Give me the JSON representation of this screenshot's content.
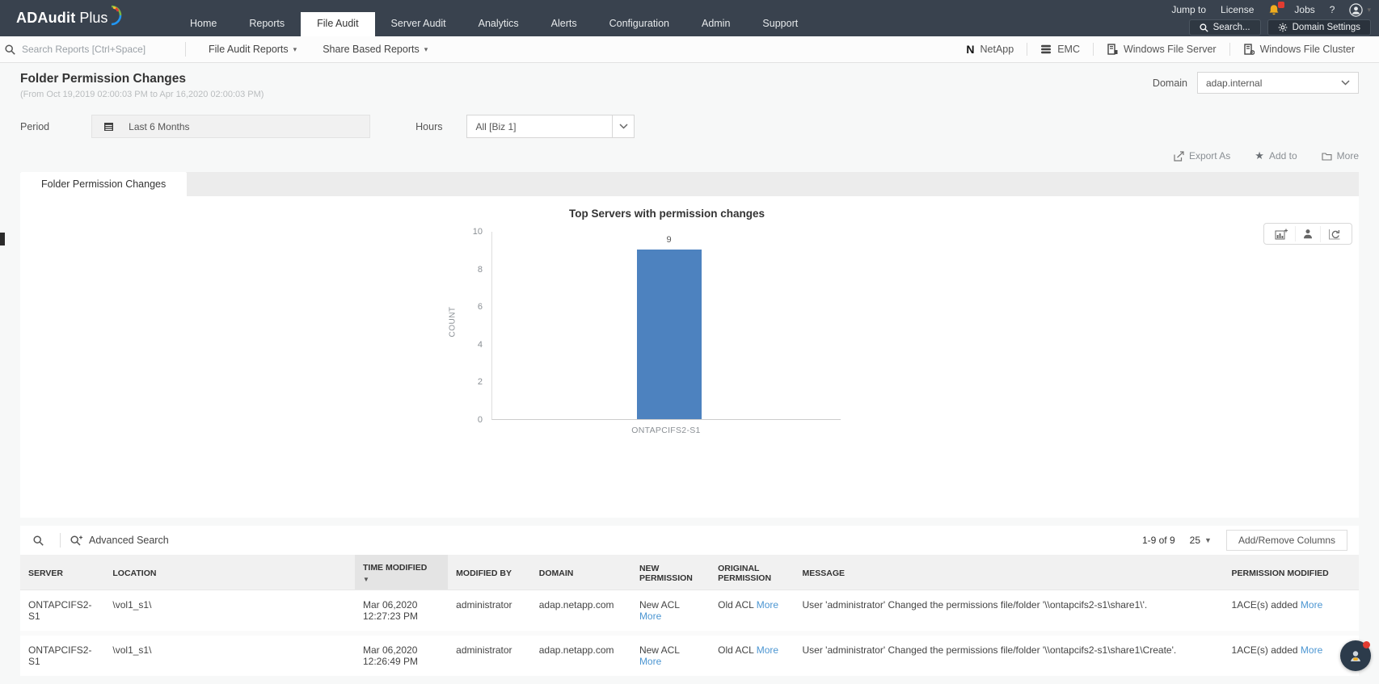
{
  "header": {
    "logo_bold": "ADAudit",
    "logo_light": "Plus",
    "nav": [
      {
        "label": "Home",
        "active": false
      },
      {
        "label": "Reports",
        "active": false
      },
      {
        "label": "File Audit",
        "active": true
      },
      {
        "label": "Server Audit",
        "active": false
      },
      {
        "label": "Analytics",
        "active": false
      },
      {
        "label": "Alerts",
        "active": false
      },
      {
        "label": "Configuration",
        "active": false
      },
      {
        "label": "Admin",
        "active": false
      },
      {
        "label": "Support",
        "active": false
      }
    ],
    "jump_to": "Jump to",
    "license": "License",
    "jobs": "Jobs",
    "help": "?",
    "search_button": "Search...",
    "domain_settings_button": "Domain Settings"
  },
  "toolbar": {
    "search_placeholder": "Search Reports [Ctrl+Space]",
    "dropdowns": [
      "File Audit Reports",
      "Share Based Reports"
    ],
    "storage_links": [
      {
        "label": "NetApp",
        "name": "netapp-button",
        "icon": "netapp-icon"
      },
      {
        "label": "EMC",
        "name": "emc-button",
        "icon": "emc-icon"
      },
      {
        "label": "Windows File Server",
        "name": "windows-file-server-button",
        "icon": "file-server-icon"
      },
      {
        "label": "Windows File Cluster",
        "name": "windows-file-cluster-button",
        "icon": "file-cluster-icon"
      }
    ]
  },
  "page": {
    "title": "Folder Permission Changes",
    "date_range": "(From Oct 19,2019 02:00:03 PM to Apr 16,2020 02:00:03 PM)",
    "domain_label": "Domain",
    "domain_value": "adap.internal"
  },
  "filters": {
    "period_label": "Period",
    "period_value": "Last 6 Months",
    "hours_label": "Hours",
    "hours_value": "All [Biz 1]"
  },
  "actions": {
    "export_as": "Export As",
    "add_to": "Add to",
    "more": "More"
  },
  "tab_label": "Folder Permission Changes",
  "chart_data": {
    "type": "bar",
    "title": "Top Servers with permission changes",
    "categories": [
      "ONTAPCIFS2-S1"
    ],
    "values": [
      9
    ],
    "xlabel": "",
    "ylabel": "COUNT",
    "ylim": [
      0,
      10
    ],
    "yticks": [
      0,
      2,
      4,
      6,
      8,
      10
    ],
    "bar_color": "#4d82bf",
    "grid": false,
    "legend": false
  },
  "table": {
    "advanced_search_label": "Advanced Search",
    "pagination": "1-9 of 9",
    "page_size": "25",
    "add_remove_columns": "Add/Remove Columns",
    "more_label": "More",
    "headers": [
      "SERVER",
      "LOCATION",
      "TIME MODIFIED",
      "MODIFIED BY",
      "DOMAIN",
      "NEW PERMISSION",
      "ORIGINAL PERMISSION",
      "MESSAGE",
      "PERMISSION MODIFIED"
    ],
    "rows": [
      {
        "server": "ONTAPCIFS2-S1",
        "location": "\\vol1_s1\\",
        "time_modified": "Mar 06,2020 12:27:23 PM",
        "modified_by": "administrator",
        "domain": "adap.netapp.com",
        "new_permission": "New ACL",
        "original_permission": "Old ACL",
        "message": "User 'administrator' Changed the permissions file/folder '\\\\ontapcifs2-s1\\share1\\'.",
        "permission_modified": "1ACE(s) added"
      },
      {
        "server": "ONTAPCIFS2-S1",
        "location": "\\vol1_s1\\",
        "time_modified": "Mar 06,2020 12:26:49 PM",
        "modified_by": "administrator",
        "domain": "adap.netapp.com",
        "new_permission": "New ACL",
        "original_permission": "Old ACL",
        "message": "User 'administrator' Changed the permissions file/folder '\\\\ontapcifs2-s1\\share1\\Create'.",
        "permission_modified": "1ACE(s) added"
      }
    ]
  },
  "colors": {
    "header_bg": "#39424e",
    "accent": "#4d82bf",
    "link": "#4c96d2",
    "bell": "#f0ad1e",
    "badge": "#e23c31"
  }
}
